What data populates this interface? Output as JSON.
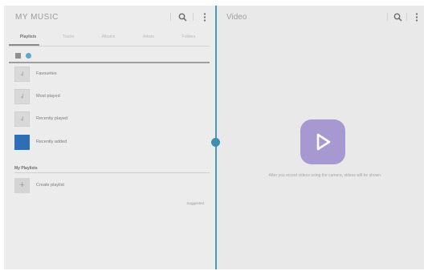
{
  "music": {
    "title": "MY MUSIC",
    "tabs": [
      {
        "label": "Playlists"
      },
      {
        "label": "Tracks"
      },
      {
        "label": "Albums"
      },
      {
        "label": "Artists"
      },
      {
        "label": "Folders"
      }
    ],
    "playlists": [
      {
        "label": "Favourites"
      },
      {
        "label": "Most played"
      },
      {
        "label": "Recently played"
      },
      {
        "label": "Recently added"
      }
    ],
    "my_playlists_header": "My Playlists",
    "create_playlist": "Create playlist",
    "small_link": "Suggested"
  },
  "video": {
    "title": "Video",
    "empty_message": "After you record videos using the camera, videos will be shown."
  },
  "colors": {
    "accent": "#4f98b6",
    "video_tile": "#a798d2",
    "recently_added_thumb": "#2f6db4"
  }
}
